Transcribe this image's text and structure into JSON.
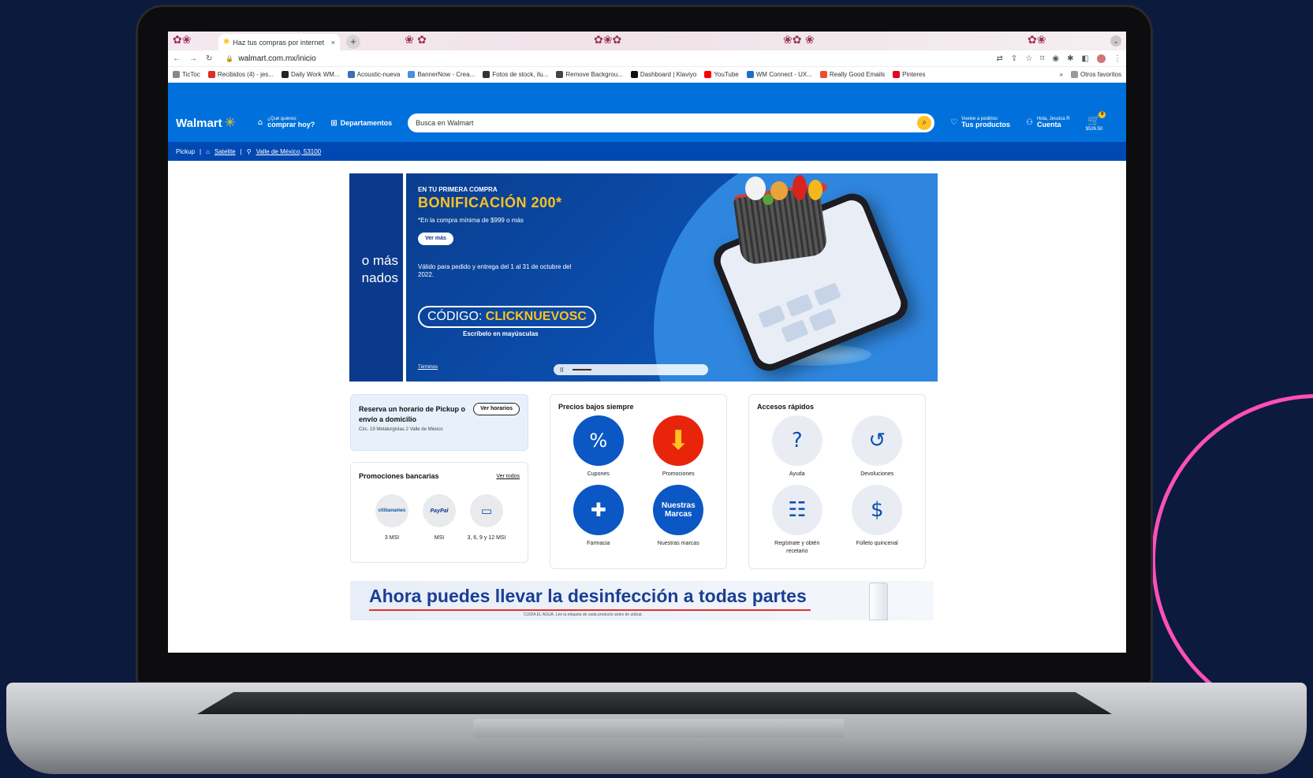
{
  "browser": {
    "tab_title": "Haz tus compras por internet",
    "tab_close": "×",
    "new_tab": "+",
    "url": "walmart.com.mx/inicio",
    "bookmarks": [
      {
        "label": "TicToc",
        "color": "#888888"
      },
      {
        "label": "Recibidos (4) - jes...",
        "color": "#d93025"
      },
      {
        "label": "Daily Work WM...",
        "color": "#222222"
      },
      {
        "label": "Acoustic-nueva",
        "color": "#3b6fb6"
      },
      {
        "label": "BannerNow - Crea...",
        "color": "#4a90e2"
      },
      {
        "label": "Fotos de stock, ilu...",
        "color": "#333333"
      },
      {
        "label": "Remove Backgrou...",
        "color": "#444444"
      },
      {
        "label": "Dashboard | Klaviyo",
        "color": "#111111"
      },
      {
        "label": "YouTube",
        "color": "#ff0000"
      },
      {
        "label": "WM Connect - UX...",
        "color": "#1b6fd1"
      },
      {
        "label": "Really Good Emails",
        "color": "#e8502f"
      },
      {
        "label": "Pinteres",
        "color": "#e60023"
      }
    ],
    "bookmarks_overflow": "»",
    "other_bookmarks": "Otros favoritos"
  },
  "header": {
    "logo": "Walmart",
    "shop_line1": "¿Qué quieres",
    "shop_line2": "comprar hoy?",
    "departments": "Departamentos",
    "search_placeholder": "Busca en Walmart",
    "reorder_line1": "Vuelve a pedirlos",
    "reorder_line2": "Tus productos",
    "account_line1": "Hola, Jessica R",
    "account_line2": "Cuenta",
    "cart_count": "0",
    "cart_total": "$526.50"
  },
  "location_bar": {
    "mode": "Pickup",
    "separator": "|",
    "store": "Satelite",
    "address": "Valle de México, 53100"
  },
  "carousel_prev": {
    "line1": "o más",
    "line2": "nados"
  },
  "hero": {
    "eyebrow": "EN TU PRIMERA COMPRA",
    "title": "BONIFICACIÓN 200*",
    "subtitle": "*En la compra mínima de $999 o más",
    "button": "Ver más",
    "validity": "Válido para pedido y entrega del 1 al 31 de octubre del 2022.",
    "code_prefix": "CÓDIGO:",
    "code": "CLICKNUEVOSC",
    "code_note": "Escríbelo en mayúsculas",
    "terms": "Términos",
    "pause": "II"
  },
  "pickup": {
    "title": "Reserva un horario de Pickup o envío a domicilio",
    "address": "Circ. 19 Metalurgistas 2 Valle de México",
    "button": "Ver horarios"
  },
  "banks": {
    "title": "Promociones bancarias",
    "see_all": "Ver todos",
    "items": [
      {
        "logo": "citibanamex",
        "label": "3 MSI"
      },
      {
        "logo": "PayPal",
        "label": "MSI"
      },
      {
        "logo": "card",
        "label": "3, 6, 9 y 12 MSI"
      }
    ]
  },
  "prices": {
    "title": "Precios bajos siempre",
    "items": [
      {
        "label": "Cupones",
        "icon": "coupon-icon"
      },
      {
        "label": "Promociones",
        "icon": "arrow-down-icon"
      },
      {
        "label": "Farmacia",
        "icon": "pharmacy-icon"
      },
      {
        "label": "Nuestras marcas",
        "icon": "brand-icon",
        "brand_text": "Nuestras Marcas"
      }
    ]
  },
  "quick_access": {
    "title": "Accesos rápidos",
    "items": [
      {
        "label": "Ayuda",
        "icon": "help-icon"
      },
      {
        "label": "Devoluciones",
        "icon": "return-icon"
      },
      {
        "label": "Regístrate y obtén recetario",
        "icon": "recipe-book-icon"
      },
      {
        "label": "Folleto quincenal",
        "icon": "flyer-icon"
      }
    ]
  },
  "promo_banner": {
    "text": "Ahora puedes llevar la desinfección a todas partes",
    "fine_print": "CUIDA EL AGUA. Lee la etiqueta de cada producto antes de utilizar."
  },
  "colors": {
    "walmart_blue": "#0071dc",
    "walmart_dark_blue": "#0049b3",
    "spark_yellow": "#ffc220",
    "background": "#0c1a3d",
    "accent_pink": "#ff4fb8"
  }
}
